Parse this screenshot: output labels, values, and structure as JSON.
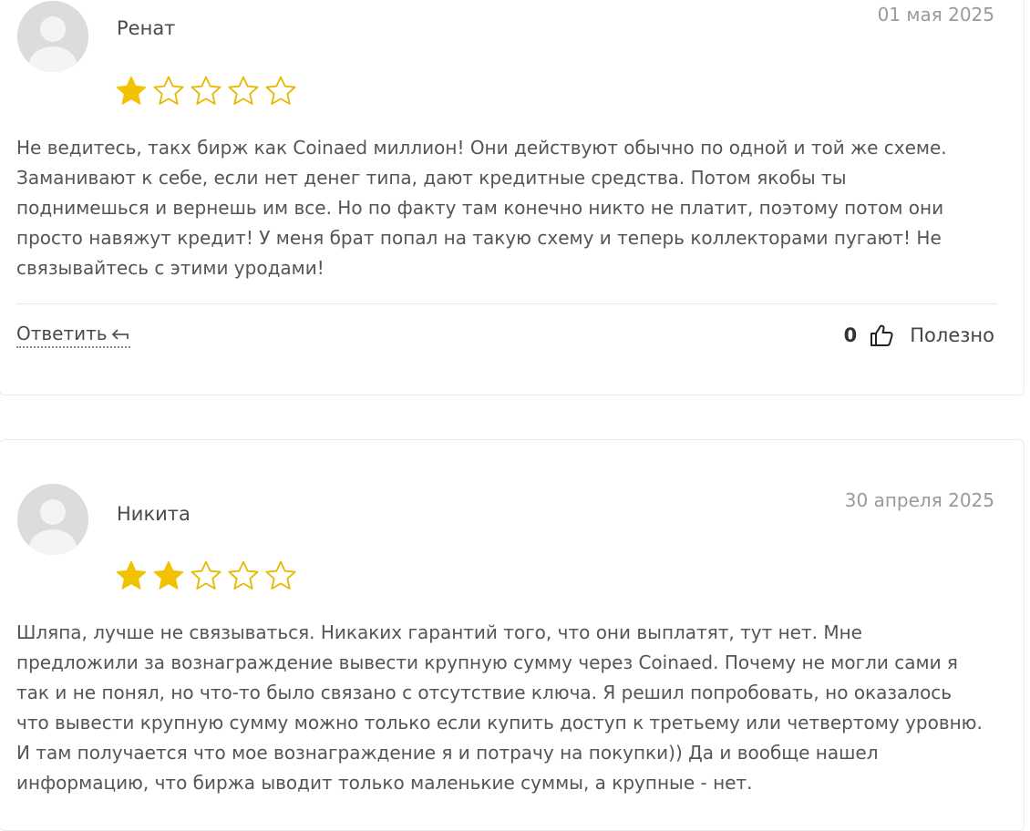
{
  "reviews": [
    {
      "author": "Ренат",
      "date": "01 мая 2025",
      "rating": 1,
      "max_rating": 5,
      "text": "Не ведитесь, такх бирж как Coinaed миллион! Они действуют обычно по одной и той же схеме. Заманивают к себе, если нет денег типа, дают кредитные средства. Потом якобы ты поднимешься и вернешь им все. Но по факту там конечно никто не платит, поэтому потом они просто навяжут кредит! У меня брат попал на такую схему и теперь коллекторами пугают! Не связывайтесь с этими уродами!",
      "reply_label": "Ответить",
      "helpful_count": "0",
      "helpful_label": "Полезно"
    },
    {
      "author": "Никита",
      "date": "30 апреля 2025",
      "rating": 2,
      "max_rating": 5,
      "text": "Шляпа, лучше не связываться. Никаких гарантий того, что они выплатят, тут нет. Мне предложили за вознаграждение вывести крупную сумму через Coinaed. Почему не могли сами я так и не понял, но что-то было связано с отсутствие ключа. Я решил попробовать, но оказалось что вывести крупную сумму можно только если купить доступ к третьему или четвертому уровню. И там получается что мое вознаграждение я и потрачу на покупки)) Да и вообще нашел информацию, что биржа ыводит только маленькие суммы, а крупные - нет."
    }
  ],
  "colors": {
    "star_filled": "#f2c200",
    "star_empty_outline": "#e7b800",
    "avatar_bg": "#dcdcdc",
    "avatar_fg": "#f4f4f4"
  },
  "icons": {
    "avatar": "avatar-placeholder-icon",
    "star_filled": "star-filled-icon",
    "star_empty": "star-outline-icon",
    "reply": "reply-arrow-icon",
    "thumb": "thumbs-up-icon"
  }
}
